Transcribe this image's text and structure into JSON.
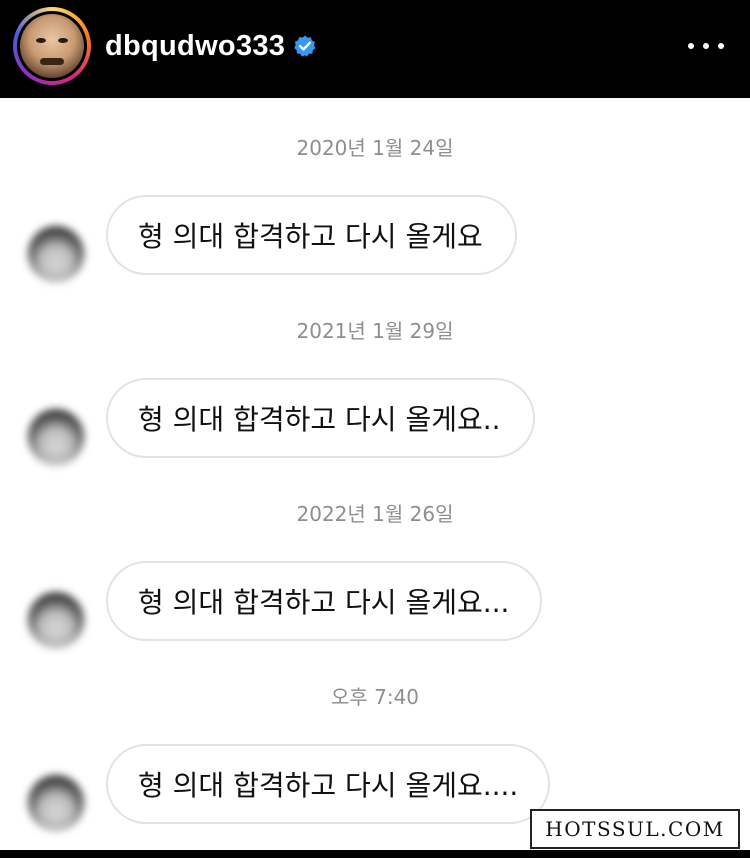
{
  "header": {
    "username": "dbqudwo333",
    "verified_icon": "verified-badge-icon",
    "more_icon": "more-options-icon",
    "accent_color": "#3897f0"
  },
  "messages": [
    {
      "timestamp": "2020년 1월 24일",
      "text": "형 의대 합격하고 다시 올게요"
    },
    {
      "timestamp": "2021년 1월 29일",
      "text": "형 의대 합격하고 다시 올게요.."
    },
    {
      "timestamp": "2022년 1월 26일",
      "text": "형 의대 합격하고 다시 올게요..."
    },
    {
      "timestamp": "오후 7:40",
      "text": "형 의대 합격하고 다시 올게요...."
    }
  ],
  "watermark": "HOTSSUL.COM"
}
